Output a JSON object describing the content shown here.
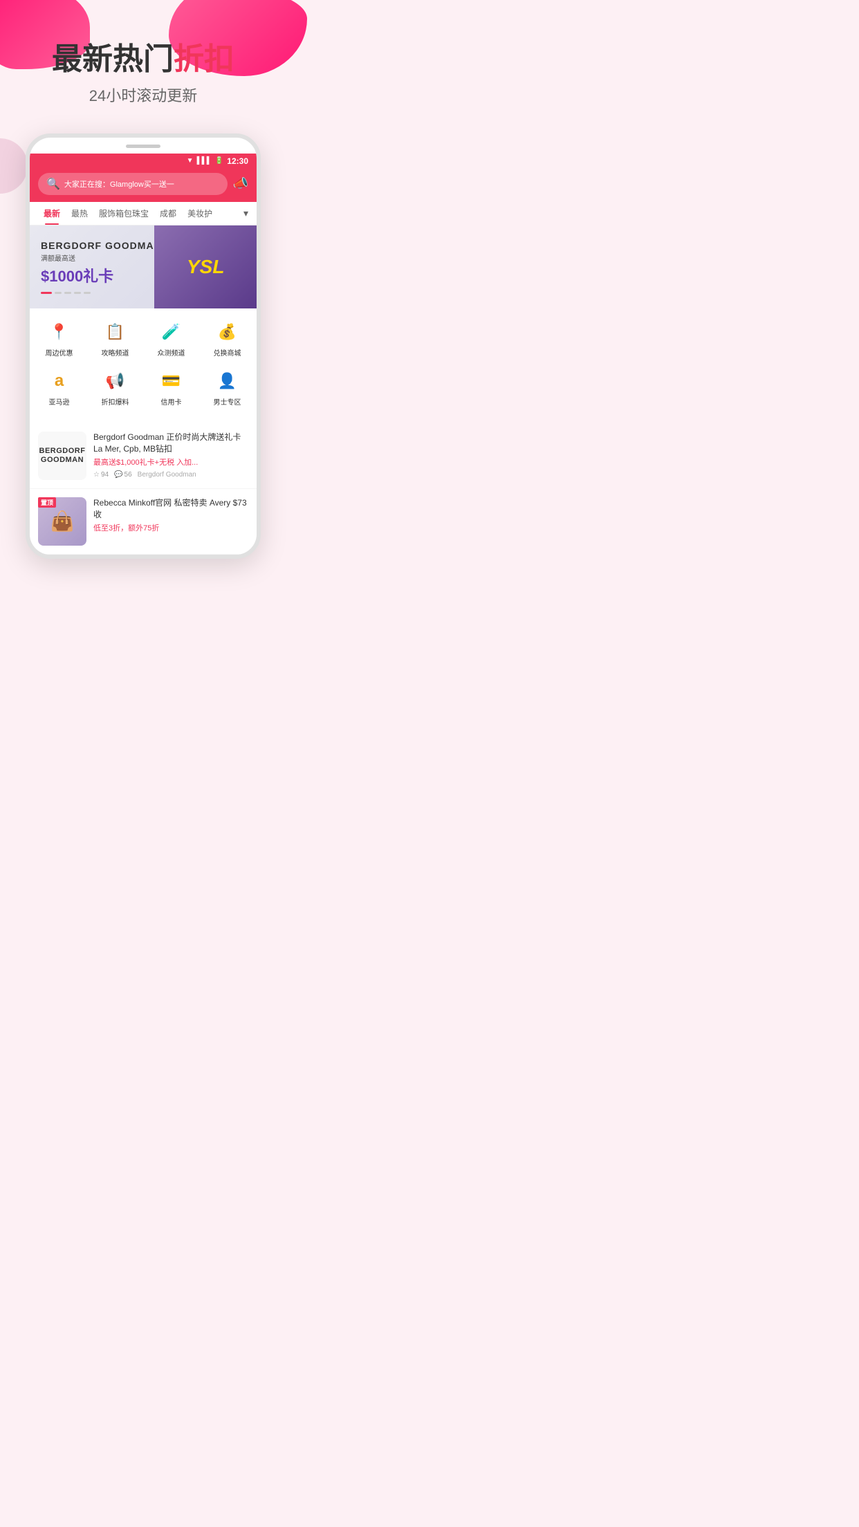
{
  "hero": {
    "title_black": "最新热门",
    "title_red": "折扣",
    "subtitle": "24小时滚动更新"
  },
  "status_bar": {
    "time": "12:30",
    "wifi_icon": "▼",
    "signal_icon": "▌",
    "battery_icon": "▮"
  },
  "app_header": {
    "search_placeholder": "大家正在搜：Glamglow买一送一",
    "megaphone_icon": "📣"
  },
  "nav_tabs": {
    "tabs": [
      {
        "label": "最新",
        "active": true
      },
      {
        "label": "最热",
        "active": false
      },
      {
        "label": "服饰箱包珠宝",
        "active": false
      },
      {
        "label": "成都",
        "active": false
      },
      {
        "label": "美妆护",
        "active": false
      }
    ],
    "more_icon": "▾"
  },
  "banner": {
    "brand": "BERGDORF GOODMAN",
    "sub_text": "满额最高送",
    "amount": "$1000礼卡",
    "ysl_text": "YSL"
  },
  "categories": [
    {
      "icon": "📍",
      "label": "周边优惠",
      "icon_name": "location-icon"
    },
    {
      "icon": "📋",
      "label": "攻略频道",
      "icon_name": "guide-icon"
    },
    {
      "icon": "🧪",
      "label": "众测频道",
      "icon_name": "test-icon"
    },
    {
      "icon": "💰",
      "label": "兑换商城",
      "icon_name": "exchange-icon"
    },
    {
      "icon": "🅰",
      "label": "亚马逊",
      "icon_name": "amazon-icon"
    },
    {
      "icon": "📢",
      "label": "折扣爆料",
      "icon_name": "discount-icon"
    },
    {
      "icon": "💳",
      "label": "信用卡",
      "icon_name": "creditcard-icon"
    },
    {
      "icon": "👤",
      "label": "男士专区",
      "icon_name": "men-icon"
    }
  ],
  "deals": [
    {
      "logo_line1": "BERGDORF",
      "logo_line2": "GOODMAN",
      "title": "Bergdorf Goodman 正价时尚大牌送礼卡 La Mer, Cpb, MB钻扣",
      "subtitle": "最高送$1,000礼卡+无税 入加...",
      "stars": "94",
      "comments": "56",
      "store": "Bergdorf Goodman",
      "star_icon": "☆",
      "comment_icon": "💬"
    },
    {
      "badge": "置顶",
      "image_icon": "👜",
      "title": "Rebecca Minkoff官网 私密特卖 Avery $73收",
      "subtitle": "低至3折，额外75折",
      "stars": "",
      "comments": "",
      "store": ""
    }
  ]
}
